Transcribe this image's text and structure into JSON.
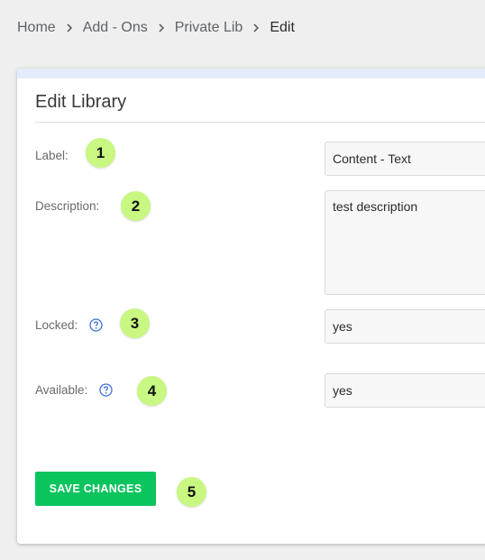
{
  "breadcrumb": {
    "items": [
      "Home",
      "Add - Ons",
      "Private Lib"
    ],
    "current": "Edit",
    "separator_icon": "chevron-right-icon"
  },
  "card": {
    "title": "Edit Library",
    "accent_color": "#e3ecfb"
  },
  "form": {
    "label": {
      "label": "Label:",
      "value": "Content - Text"
    },
    "description": {
      "label": "Description:",
      "value": "test description"
    },
    "locked": {
      "label": "Locked:",
      "value": "yes",
      "help_icon": "question-circle-icon"
    },
    "available": {
      "label": "Available:",
      "value": "yes",
      "help_icon": "question-circle-icon"
    }
  },
  "actions": {
    "save_label": "SAVE CHANGES",
    "save_color": "#0ac45e"
  },
  "annotations": {
    "color": "#c8f782",
    "labels": [
      "1",
      "2",
      "3",
      "4",
      "5"
    ]
  }
}
